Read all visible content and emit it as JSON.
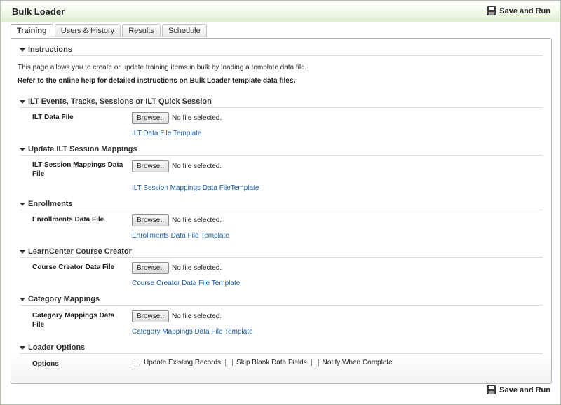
{
  "header": {
    "title": "Bulk Loader",
    "save_run_label": "Save and Run"
  },
  "tabs": [
    {
      "label": "Training",
      "active": true
    },
    {
      "label": "Users & History",
      "active": false
    },
    {
      "label": "Results",
      "active": false
    },
    {
      "label": "Schedule",
      "active": false
    }
  ],
  "instructions": {
    "title": "Instructions",
    "line1": "This page allows you to create or update training items in bulk by loading a template data file.",
    "line2": "Refer to the online help for detailed instructions on Bulk Loader template data files."
  },
  "sections": {
    "ilt": {
      "title": "ILT Events, Tracks, Sessions or ILT Quick Session",
      "label": "ILT Data File",
      "browse": "Browse..",
      "nofile": "No file selected.",
      "link": "ILT Data File Template"
    },
    "ilt_mappings": {
      "title": "Update ILT Session Mappings",
      "label": "ILT Session Mappings Data File",
      "browse": "Browse..",
      "nofile": "No file selected.",
      "link": "ILT Session Mappings Data FileTemplate"
    },
    "enrollments": {
      "title": "Enrollments",
      "label": "Enrollments Data File",
      "browse": "Browse..",
      "nofile": "No file selected.",
      "link": "Enrollments Data File Template"
    },
    "course_creator": {
      "title": "LearnCenter Course Creator",
      "label": "Course Creator Data File",
      "browse": "Browse..",
      "nofile": "No file selected.",
      "link": "Course Creator Data File Template"
    },
    "category": {
      "title": "Category Mappings",
      "label": "Category Mappings Data File",
      "browse": "Browse..",
      "nofile": "No file selected.",
      "link": "Category Mappings Data File Template"
    },
    "loader_options": {
      "title": "Loader Options",
      "label": "Options",
      "options": [
        "Update Existing Records",
        "Skip Blank Data Fields",
        "Notify When Complete"
      ]
    }
  },
  "colors": {
    "header_gradient_end": "#dff2cf",
    "link": "#1a5b9e"
  }
}
